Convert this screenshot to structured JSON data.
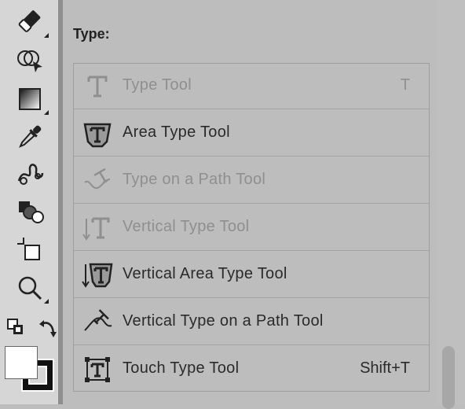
{
  "panel": {
    "title": "Type:"
  },
  "tools": [
    {
      "label": "Type Tool",
      "shortcut": "T",
      "disabled": true,
      "icon": "type-icon"
    },
    {
      "label": "Area Type Tool",
      "shortcut": "",
      "disabled": false,
      "icon": "area-type-icon"
    },
    {
      "label": "Type on a Path Tool",
      "shortcut": "",
      "disabled": true,
      "icon": "type-on-path-icon"
    },
    {
      "label": "Vertical Type Tool",
      "shortcut": "",
      "disabled": true,
      "icon": "vertical-type-icon"
    },
    {
      "label": "Vertical Area Type Tool",
      "shortcut": "",
      "disabled": false,
      "icon": "vertical-area-type-icon"
    },
    {
      "label": "Vertical Type on a Path Tool",
      "shortcut": "",
      "disabled": false,
      "icon": "vertical-type-on-path-icon"
    },
    {
      "label": "Touch Type Tool",
      "shortcut": "Shift+T",
      "disabled": false,
      "icon": "touch-type-icon"
    }
  ],
  "toolbar": {
    "icons": [
      "eraser-icon",
      "shape-builder-icon",
      "gradient-icon",
      "eyedropper-icon",
      "blend-icon",
      "live-paint-icon",
      "artboard-icon",
      "zoom-icon",
      "default-colors-icon",
      "swap-colors-icon",
      "fill-swatch-icon",
      "stroke-swatch-icon"
    ]
  },
  "colors": {
    "background": "#bdbdbd",
    "toolbar": "#d6d6d6",
    "text": "#2a2a2a",
    "disabled_text": "#8f8f8f"
  }
}
